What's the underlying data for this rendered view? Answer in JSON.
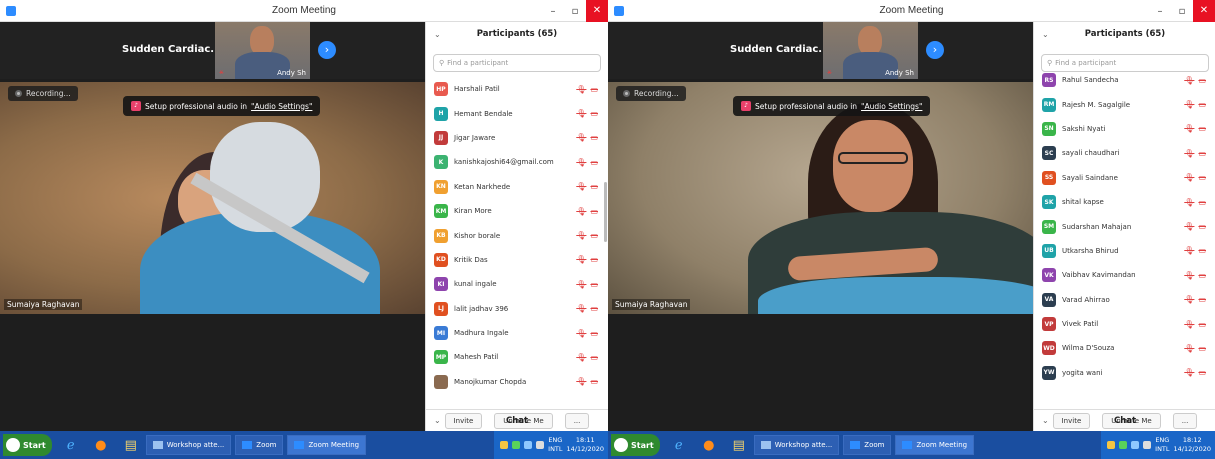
{
  "screens": [
    {
      "title": "Zoom Meeting",
      "meeting_name": "Sudden Cardiac...",
      "thumb_name": "Andy Sh",
      "recording": "Recording...",
      "audio_tip": "Setup professional audio in",
      "audio_link": "\"Audio Settings\"",
      "speaker": "Sumaiya Raghavan",
      "panel_title": "Participants (65)",
      "search_placeholder": "Find a participant",
      "participants": [
        {
          "initials": "HP",
          "name": "Harshali Patil",
          "color": "#e85a4f"
        },
        {
          "initials": "H",
          "name": "Hemant Bendale",
          "color": "#1fa3a8"
        },
        {
          "initials": "JJ",
          "name": "Jigar Jaware",
          "color": "#c23b3b"
        },
        {
          "initials": "K",
          "name": "kanishkajoshi64@gmail.com",
          "color": "#3cb371"
        },
        {
          "initials": "KN",
          "name": "Ketan Narkhede",
          "color": "#f0a030"
        },
        {
          "initials": "KM",
          "name": "Kiran More",
          "color": "#3ab54a"
        },
        {
          "initials": "KB",
          "name": "Kishor borale",
          "color": "#f0a030"
        },
        {
          "initials": "KD",
          "name": "Kritik Das",
          "color": "#e05020"
        },
        {
          "initials": "KI",
          "name": "kunal ingale",
          "color": "#8e44ad"
        },
        {
          "initials": "LJ",
          "name": "lalit jadhav 396",
          "color": "#e05020"
        },
        {
          "initials": "MI",
          "name": "Madhura Ingale",
          "color": "#3a7bd5"
        },
        {
          "initials": "MP",
          "name": "Mahesh Patil",
          "color": "#3ab54a"
        },
        {
          "initials": "",
          "name": "Manojkumar Chopda",
          "color": "#8a6a50"
        }
      ],
      "invite": "Invite",
      "unmute": "Unmute Me",
      "more": "...",
      "chat": "Chat",
      "clock_time": "18:11",
      "clock_date": "14/12/2020"
    },
    {
      "title": "Zoom Meeting",
      "meeting_name": "Sudden Cardiac...",
      "thumb_name": "Andy Sh",
      "recording": "Recording...",
      "audio_tip": "Setup professional audio in",
      "audio_link": "\"Audio Settings\"",
      "speaker": "Sumaiya Raghavan",
      "panel_title": "Participants (65)",
      "search_placeholder": "Find a participant",
      "participants": [
        {
          "initials": "RS",
          "name": "Rahul Sandecha",
          "color": "#8e44ad"
        },
        {
          "initials": "RM",
          "name": "Rajesh M. Sagalgile",
          "color": "#1fa3a8"
        },
        {
          "initials": "SN",
          "name": "Sakshi Nyati",
          "color": "#3ab54a"
        },
        {
          "initials": "SC",
          "name": "sayali chaudhari",
          "color": "#2c3e50"
        },
        {
          "initials": "SS",
          "name": "Sayali Saindane",
          "color": "#e05020"
        },
        {
          "initials": "SK",
          "name": "shital kapse",
          "color": "#1fa3a8"
        },
        {
          "initials": "SM",
          "name": "Sudarshan Mahajan",
          "color": "#3ab54a"
        },
        {
          "initials": "UB",
          "name": "Utkarsha Bhirud",
          "color": "#1fa3a8"
        },
        {
          "initials": "VK",
          "name": "Vaibhav Kavimandan",
          "color": "#8e44ad"
        },
        {
          "initials": "VA",
          "name": "Varad Ahirrao",
          "color": "#2c3e50"
        },
        {
          "initials": "VP",
          "name": "Vivek Patil",
          "color": "#c23b3b"
        },
        {
          "initials": "WD",
          "name": "Wilma D'Souza",
          "color": "#c23b3b"
        },
        {
          "initials": "YW",
          "name": "yogita wani",
          "color": "#2c3e50"
        }
      ],
      "invite": "Invite",
      "unmute": "Unmute Me",
      "more": "...",
      "chat": "Chat",
      "clock_time": "18:12",
      "clock_date": "14/12/2020"
    }
  ],
  "taskbar": {
    "start": "Start",
    "task1": "Workshop atte...",
    "task2": "Zoom",
    "task3": "Zoom Meeting",
    "lang": "ENG",
    "lang2": "INTL"
  },
  "colors": {
    "zoom_blue": "#2d8cff",
    "taskbar": "#1a4ea0"
  },
  "icons": [
    "search-icon",
    "mic-muted-icon",
    "video-off-icon",
    "chevron-down-icon",
    "next-arrow-icon",
    "start-orb-icon",
    "ie-icon",
    "firefox-icon",
    "folder-icon"
  ]
}
